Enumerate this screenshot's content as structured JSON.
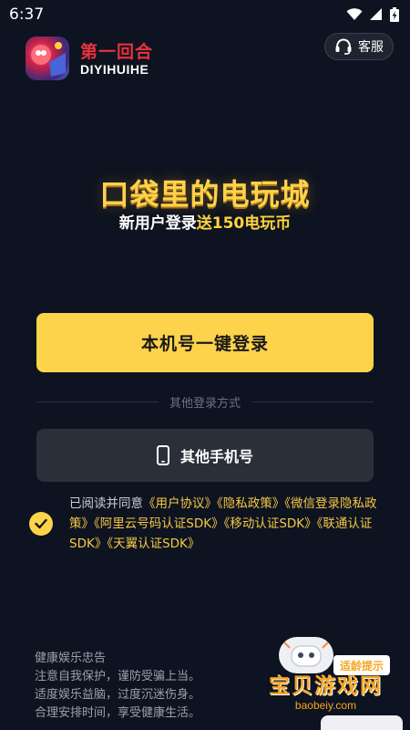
{
  "status_bar": {
    "time": "6:37"
  },
  "header": {
    "app_name": "第一回合",
    "app_name_en": "DIYIHUIHE",
    "service_label": "客服",
    "service_icon": "headset-icon"
  },
  "hero": {
    "slogan": "口袋里的电玩城",
    "promo_prefix": "新用户登录",
    "promo_highlight": "送150电玩币"
  },
  "login": {
    "one_click_label": "本机号一键登录",
    "divider_label": "其他登录方式",
    "other_phone_label": "其他手机号",
    "phone_icon": "phone-icon"
  },
  "agreement": {
    "checked": true,
    "prefix": "已阅读并同意",
    "links": [
      "《用户协议》",
      "《隐私政策》",
      "《微信登录隐私政策》",
      "《阿里云号码认证SDK》",
      "《移动认证SDK》",
      "《联通认证SDK》",
      "《天翼认证SDK》"
    ]
  },
  "health_notice": {
    "title": "健康娱乐忠告",
    "lines": [
      "注意自我保护，谨防受骗上当。",
      "适度娱乐益脑，过度沉迷伤身。",
      "合理安排时间，享受健康生活。"
    ]
  },
  "watermark": {
    "badge": "适龄提示",
    "title": "宝贝游戏网",
    "url": "baobeiy.com"
  },
  "colors": {
    "background": "#0d1320",
    "primary_button": "#fcd34a",
    "secondary_button": "#2a2f3a",
    "accent_yellow": "#ffd43b",
    "brand_red": "#e8323c"
  }
}
